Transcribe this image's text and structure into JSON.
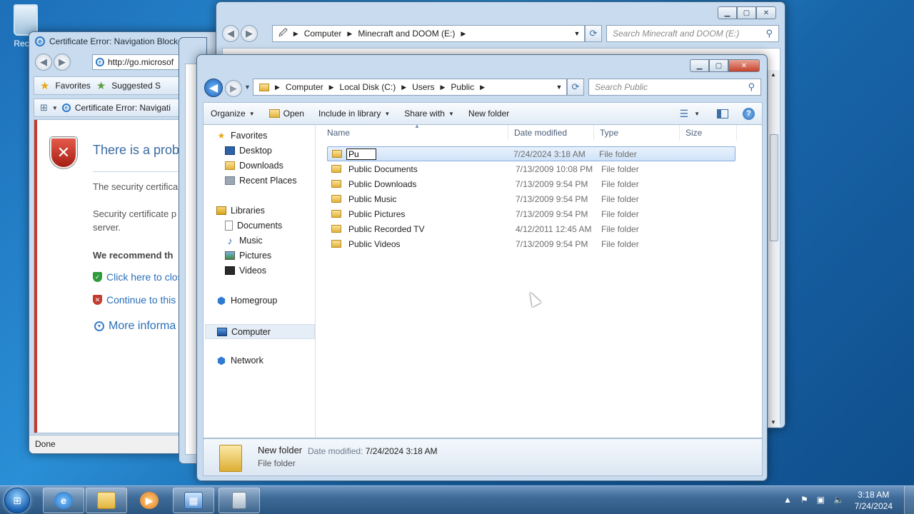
{
  "desktop": {
    "recycle_label": "Recyc"
  },
  "ie": {
    "title": "Certificate Error: Navigation Blocke",
    "url": "http://go.microsof",
    "favorites_label": "Favorites",
    "suggested_label": "Suggested S",
    "tab_label": "Certificate Error: Navigati",
    "error_title": "There is a probl",
    "para1": "The security certifica",
    "para2a": "Security certificate p",
    "para2b": "server.",
    "recommend": "We recommend th",
    "link_close": "Click here to clos",
    "link_continue": "Continue to this",
    "link_more": "More informa",
    "status": "Done"
  },
  "explorer_back": {
    "breadcrumb": [
      "Computer",
      "Minecraft and DOOM (E:)"
    ],
    "search_placeholder": "Search Minecraft and DOOM (E:)"
  },
  "explorer": {
    "breadcrumb": [
      "Computer",
      "Local Disk (C:)",
      "Users",
      "Public"
    ],
    "search_placeholder": "Search Public",
    "toolbar": {
      "organize": "Organize",
      "open": "Open",
      "include": "Include in library",
      "share": "Share with",
      "new_folder": "New folder"
    },
    "nav": {
      "favorites": "Favorites",
      "desktop": "Desktop",
      "downloads": "Downloads",
      "recent": "Recent Places",
      "libraries": "Libraries",
      "documents": "Documents",
      "music": "Music",
      "pictures": "Pictures",
      "videos": "Videos",
      "homegroup": "Homegroup",
      "computer": "Computer",
      "network": "Network"
    },
    "columns": {
      "name": "Name",
      "date": "Date modified",
      "type": "Type",
      "size": "Size"
    },
    "rename_value": "Pu",
    "rows": [
      {
        "name": "",
        "date": "7/24/2024 3:18 AM",
        "type": "File folder"
      },
      {
        "name": "Public Documents",
        "date": "7/13/2009 10:08 PM",
        "type": "File folder"
      },
      {
        "name": "Public Downloads",
        "date": "7/13/2009 9:54 PM",
        "type": "File folder"
      },
      {
        "name": "Public Music",
        "date": "7/13/2009 9:54 PM",
        "type": "File folder"
      },
      {
        "name": "Public Pictures",
        "date": "7/13/2009 9:54 PM",
        "type": "File folder"
      },
      {
        "name": "Public Recorded TV",
        "date": "4/12/2011 12:45 AM",
        "type": "File folder"
      },
      {
        "name": "Public Videos",
        "date": "7/13/2009 9:54 PM",
        "type": "File folder"
      }
    ],
    "details": {
      "name": "New folder",
      "modified_label": "Date modified:",
      "modified_value": "7/24/2024 3:18 AM",
      "type": "File folder"
    }
  },
  "taskbar": {
    "time": "3:18 AM",
    "date": "7/24/2024"
  }
}
